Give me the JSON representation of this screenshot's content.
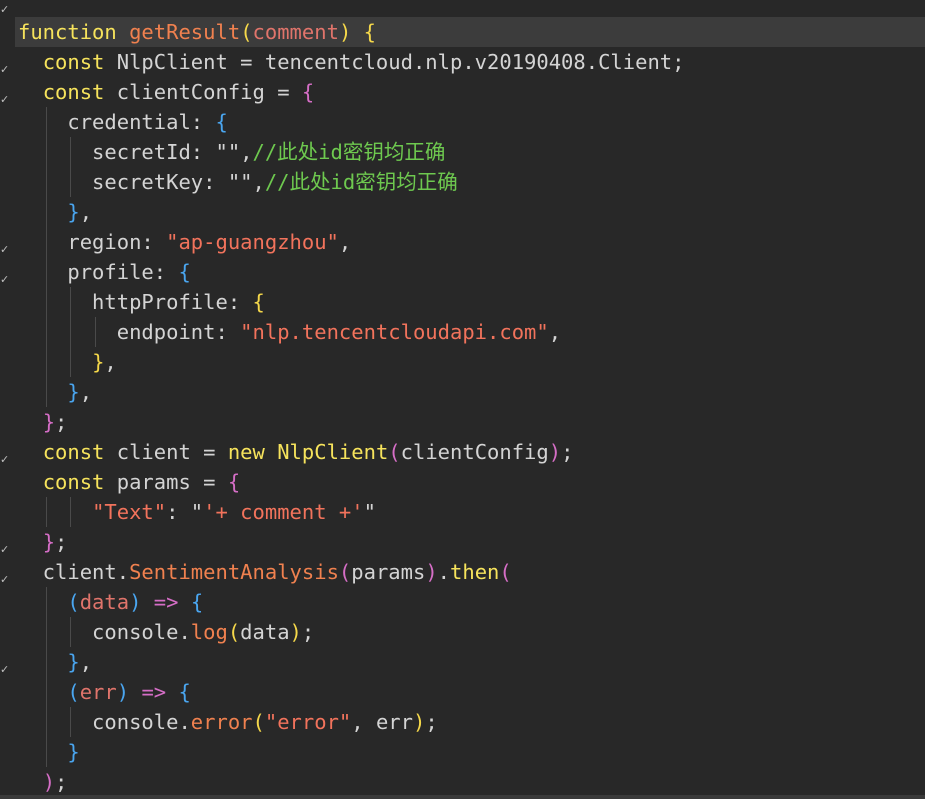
{
  "editor": {
    "language": "javascript",
    "lines": [
      [
        {
          "t": "function",
          "c": "kw"
        },
        {
          "t": " "
        },
        {
          "t": "getResult",
          "c": "fn"
        },
        {
          "t": "(",
          "c": "brY"
        },
        {
          "t": "comment",
          "c": "param"
        },
        {
          "t": ")",
          "c": "brY"
        },
        {
          "t": " "
        },
        {
          "t": "{",
          "c": "brY"
        }
      ],
      [
        {
          "t": "  "
        },
        {
          "t": "const",
          "c": "kw"
        },
        {
          "t": " NlpClient = tencentcloud.nlp.v20190408.Client;"
        }
      ],
      [
        {
          "t": "  "
        },
        {
          "t": "const",
          "c": "kw"
        },
        {
          "t": " clientConfig = "
        },
        {
          "t": "{",
          "c": "brP"
        }
      ],
      [
        {
          "t": "    credential: "
        },
        {
          "t": "{",
          "c": "brB"
        }
      ],
      [
        {
          "t": "      secretId: \"\","
        },
        {
          "t": "//此处id密钥均正确",
          "c": "cmt"
        }
      ],
      [
        {
          "t": "      secretKey: \"\","
        },
        {
          "t": "//此处id密钥均正确",
          "c": "cmt"
        }
      ],
      [
        {
          "t": "    "
        },
        {
          "t": "}",
          "c": "brB"
        },
        {
          "t": ","
        }
      ],
      [
        {
          "t": "    region: "
        },
        {
          "t": "\"ap-guangzhou\"",
          "c": "str"
        },
        {
          "t": ","
        }
      ],
      [
        {
          "t": "    profile: "
        },
        {
          "t": "{",
          "c": "brB"
        }
      ],
      [
        {
          "t": "      httpProfile: "
        },
        {
          "t": "{",
          "c": "brY"
        }
      ],
      [
        {
          "t": "        endpoint: "
        },
        {
          "t": "\"nlp.tencentcloudapi.com\"",
          "c": "str"
        },
        {
          "t": ","
        }
      ],
      [
        {
          "t": "      "
        },
        {
          "t": "}",
          "c": "brY"
        },
        {
          "t": ","
        }
      ],
      [
        {
          "t": "    "
        },
        {
          "t": "}",
          "c": "brB"
        },
        {
          "t": ","
        }
      ],
      [
        {
          "t": "  "
        },
        {
          "t": "}",
          "c": "brP"
        },
        {
          "t": ";"
        }
      ],
      [
        {
          "t": "  "
        },
        {
          "t": "const",
          "c": "kw"
        },
        {
          "t": " client = "
        },
        {
          "t": "new",
          "c": "kw"
        },
        {
          "t": " "
        },
        {
          "t": "NlpClient",
          "c": "kw"
        },
        {
          "t": "(",
          "c": "brP"
        },
        {
          "t": "clientConfig"
        },
        {
          "t": ")",
          "c": "brP"
        },
        {
          "t": ";"
        }
      ],
      [
        {
          "t": "  "
        },
        {
          "t": "const",
          "c": "kw"
        },
        {
          "t": " params = "
        },
        {
          "t": "{",
          "c": "brP"
        }
      ],
      [
        {
          "t": "      "
        },
        {
          "t": "\"Text\"",
          "c": "str"
        },
        {
          "t": ": \""
        },
        {
          "t": "'+ comment +'",
          "c": "str"
        },
        {
          "t": "\""
        }
      ],
      [
        {
          "t": "  "
        },
        {
          "t": "}",
          "c": "brP"
        },
        {
          "t": ";"
        }
      ],
      [
        {
          "t": "  client."
        },
        {
          "t": "SentimentAnalysis",
          "c": "fn"
        },
        {
          "t": "(",
          "c": "brP"
        },
        {
          "t": "params"
        },
        {
          "t": ")",
          "c": "brP"
        },
        {
          "t": "."
        },
        {
          "t": "then",
          "c": "kw"
        },
        {
          "t": "(",
          "c": "brP"
        }
      ],
      [
        {
          "t": "    "
        },
        {
          "t": "(",
          "c": "brB"
        },
        {
          "t": "data",
          "c": "param"
        },
        {
          "t": ")",
          "c": "brB"
        },
        {
          "t": " "
        },
        {
          "t": "=>",
          "c": "brP"
        },
        {
          "t": " "
        },
        {
          "t": "{",
          "c": "brB"
        }
      ],
      [
        {
          "t": "      console."
        },
        {
          "t": "log",
          "c": "fn"
        },
        {
          "t": "(",
          "c": "brY"
        },
        {
          "t": "data"
        },
        {
          "t": ")",
          "c": "brY"
        },
        {
          "t": ";"
        }
      ],
      [
        {
          "t": "    "
        },
        {
          "t": "}",
          "c": "brB"
        },
        {
          "t": ","
        }
      ],
      [
        {
          "t": "    "
        },
        {
          "t": "(",
          "c": "brB"
        },
        {
          "t": "err",
          "c": "param"
        },
        {
          "t": ")",
          "c": "brB"
        },
        {
          "t": " "
        },
        {
          "t": "=>",
          "c": "brP"
        },
        {
          "t": " "
        },
        {
          "t": "{",
          "c": "brB"
        }
      ],
      [
        {
          "t": "      console."
        },
        {
          "t": "error",
          "c": "fn"
        },
        {
          "t": "(",
          "c": "brY"
        },
        {
          "t": "\"error\"",
          "c": "str"
        },
        {
          "t": ", err"
        },
        {
          "t": ")",
          "c": "brY"
        },
        {
          "t": ";"
        }
      ],
      [
        {
          "t": "    "
        },
        {
          "t": "}",
          "c": "brB"
        }
      ],
      [
        {
          "t": "  "
        },
        {
          "t": ")",
          "c": "brP"
        },
        {
          "t": ";"
        }
      ]
    ],
    "fold_markers": [
      "✓",
      "",
      "✓",
      "✓",
      "",
      "",
      "",
      "",
      "✓",
      "✓",
      "",
      "",
      "",
      "",
      "",
      "✓",
      "",
      "",
      "✓",
      "✓",
      "",
      "",
      "✓",
      "",
      "",
      ""
    ],
    "current_line": 0
  },
  "colors": {
    "background": "#282828",
    "keyword": "#f6e35c",
    "function": "#f0814f",
    "string": "#f2735c",
    "comment": "#6ec94f"
  }
}
